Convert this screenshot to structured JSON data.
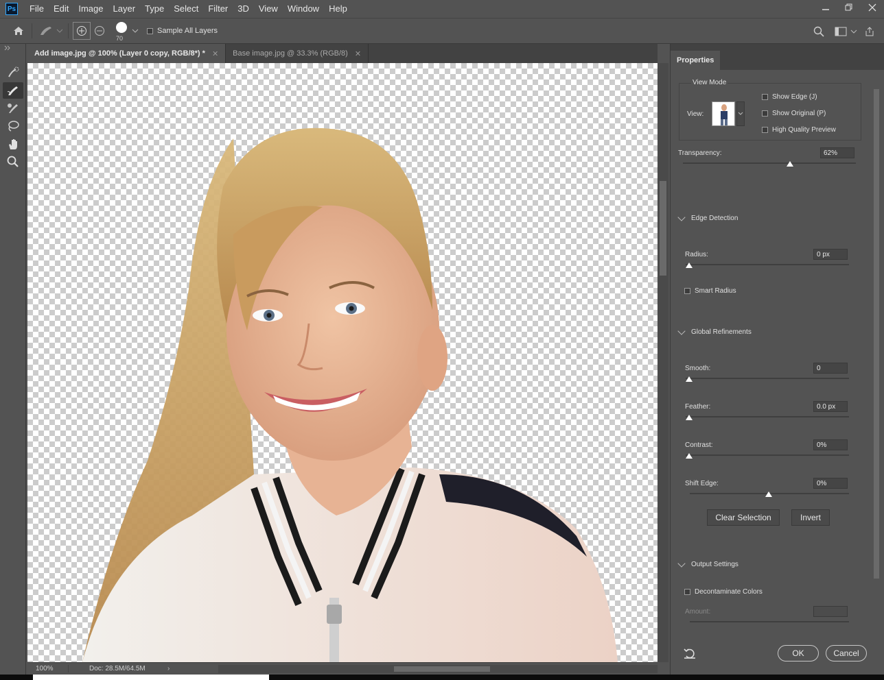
{
  "app": {
    "logo": "Ps"
  },
  "menu": [
    "File",
    "Edit",
    "Image",
    "Layer",
    "Type",
    "Select",
    "Filter",
    "3D",
    "View",
    "Window",
    "Help"
  ],
  "window_controls": {
    "minimize": "minimize-icon",
    "restore": "restore-icon",
    "close": "close-icon"
  },
  "options_bar": {
    "brush_size": "70",
    "sample_all_layers": "Sample All Layers"
  },
  "tools": [
    "quick-selection-tool",
    "refine-edge-brush-tool",
    "brush-tool",
    "lasso-tool",
    "hand-tool",
    "zoom-tool"
  ],
  "tabs": [
    {
      "label": "Add image.jpg @ 100% (Layer 0 copy, RGB/8*) *",
      "active": true
    },
    {
      "label": "Base image.jpg @ 33.3% (RGB/8)",
      "active": false
    }
  ],
  "status": {
    "zoom": "100%",
    "doc": "Doc: 28.5M/64.5M"
  },
  "properties": {
    "title": "Properties",
    "view_mode": {
      "label": "View Mode",
      "view_label": "View:",
      "show_edge": "Show Edge (J)",
      "show_original": "Show Original (P)",
      "high_quality": "High Quality Preview"
    },
    "transparency": {
      "label": "Transparency:",
      "value": "62%",
      "level": 0.62
    },
    "edge_detection": {
      "title": "Edge Detection",
      "radius_label": "Radius:",
      "radius_value": "0 px",
      "smart_radius": "Smart Radius"
    },
    "global_refinements": {
      "title": "Global Refinements",
      "smooth_label": "Smooth:",
      "smooth_value": "0",
      "feather_label": "Feather:",
      "feather_value": "0.0 px",
      "contrast_label": "Contrast:",
      "contrast_value": "0%",
      "shift_edge_label": "Shift Edge:",
      "shift_edge_value": "0%"
    },
    "buttons": {
      "clear_selection": "Clear Selection",
      "invert": "Invert"
    },
    "output": {
      "title": "Output Settings",
      "decontaminate": "Decontaminate Colors",
      "amount_label": "Amount:"
    },
    "ok": "OK",
    "cancel": "Cancel"
  }
}
